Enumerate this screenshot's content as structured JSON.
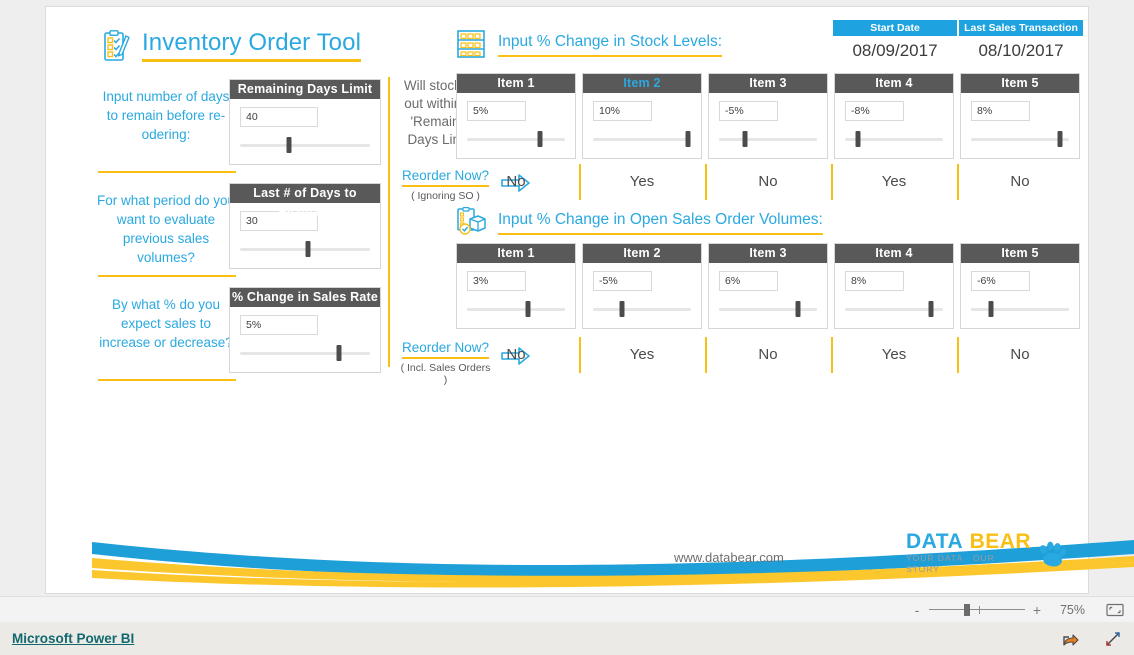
{
  "report": {
    "title": "Inventory Order Tool",
    "title_icon": "clipboard-checklist-icon"
  },
  "left_inputs": [
    {
      "question": "Input number of days to remain before re-odering:",
      "slicer_title": "Remaining Days Limit",
      "value": "40",
      "thumb_pct": 38
    },
    {
      "question": "For what period do you want to evaluate previous sales volumes?",
      "slicer_title": "Last # of Days to Evaluate",
      "value": "30",
      "thumb_pct": 52
    },
    {
      "question": "By what % do you expect sales to increase or decrease?",
      "slicer_title": "% Change in Sales Rate",
      "value": "5%",
      "thumb_pct": 76
    }
  ],
  "middle": {
    "question": "Will stock run out within the 'Remaining Days Limit'?",
    "reorder_ignoring": {
      "label": "Reorder Now?",
      "sub": "( Ignoring SO )"
    },
    "reorder_including": {
      "label": "Reorder Now?",
      "sub": "( Incl. Sales Orders )"
    },
    "arrow_icon": "right-arrow-outline-icon"
  },
  "dates": [
    {
      "header": "Start Date",
      "value": "08/09/2017"
    },
    {
      "header": "Last Sales Transaction",
      "value": "08/10/2017"
    }
  ],
  "stock_section": {
    "header": "Input % Change in Stock Levels:",
    "icon": "shelf-rack-icon",
    "items": [
      {
        "title": "Item 1",
        "value": "5%",
        "thumb_pct": 74,
        "selected": false
      },
      {
        "title": "Item 2",
        "value": "10%",
        "thumb_pct": 97,
        "selected": true
      },
      {
        "title": "Item 3",
        "value": "-5%",
        "thumb_pct": 27,
        "selected": false
      },
      {
        "title": "Item 4",
        "value": "-8%",
        "thumb_pct": 13,
        "selected": false
      },
      {
        "title": "Item 5",
        "value": "8%",
        "thumb_pct": 91,
        "selected": false
      }
    ],
    "answers": [
      "No",
      "Yes",
      "No",
      "Yes",
      "No"
    ]
  },
  "sales_order_section": {
    "header": "Input % Change in Open Sales Order Volumes:",
    "icon": "clipboard-box-icon",
    "items": [
      {
        "title": "Item 1",
        "value": "3%",
        "thumb_pct": 62,
        "selected": false
      },
      {
        "title": "Item 2",
        "value": "-5%",
        "thumb_pct": 30,
        "selected": false
      },
      {
        "title": "Item 3",
        "value": "6%",
        "thumb_pct": 81,
        "selected": false
      },
      {
        "title": "Item 4",
        "value": "8%",
        "thumb_pct": 88,
        "selected": false
      },
      {
        "title": "Item 5",
        "value": "-6%",
        "thumb_pct": 20,
        "selected": false
      }
    ],
    "answers": [
      "No",
      "Yes",
      "No",
      "Yes",
      "No"
    ]
  },
  "footer": {
    "website": "www.databear.com",
    "logo_word_1": "DATA",
    "logo_word_2": "BEAR",
    "logo_tagline": "YOUR DATA · OUR STORY",
    "paw_icon": "bear-paw-icon"
  },
  "statusbar": {
    "minus": "-",
    "plus": "+",
    "zoom_level": "75%",
    "fit_icon": "fit-to-page-icon"
  },
  "taskbar": {
    "brand": "Microsoft Power BI",
    "share_icon": "share-icon",
    "fullscreen_icon": "fullscreen-icon"
  },
  "colors": {
    "accent_blue": "#2aa9e0",
    "accent_yellow": "#f9bf15",
    "header_gray": "#595959",
    "date_header_blue": "#1ea2e0"
  }
}
